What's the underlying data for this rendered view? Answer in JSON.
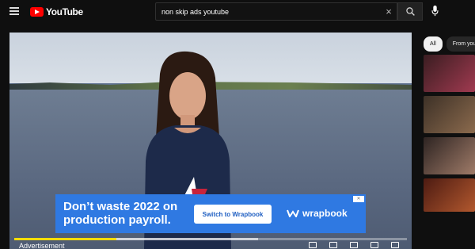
{
  "header": {
    "logo_text": "YouTube",
    "search_query": "non skip ads youtube"
  },
  "player": {
    "ad": {
      "headline_line1": "Don’t waste 2022 on",
      "headline_line2": "production payroll.",
      "cta_label": "Switch to Wrapbook",
      "brand_name": "wrapbook",
      "close_label": "✕"
    },
    "advertisement_label": "Advertisement",
    "ad_progress": 0.26,
    "buffered": 0.62
  },
  "sidebar": {
    "chips": [
      "All",
      "From you"
    ]
  },
  "colors": {
    "brand_red": "#ff0000",
    "ad_blue": "#2f79e2",
    "ad_progress_yellow": "#fbdd00",
    "background": "#0f0f0f"
  }
}
